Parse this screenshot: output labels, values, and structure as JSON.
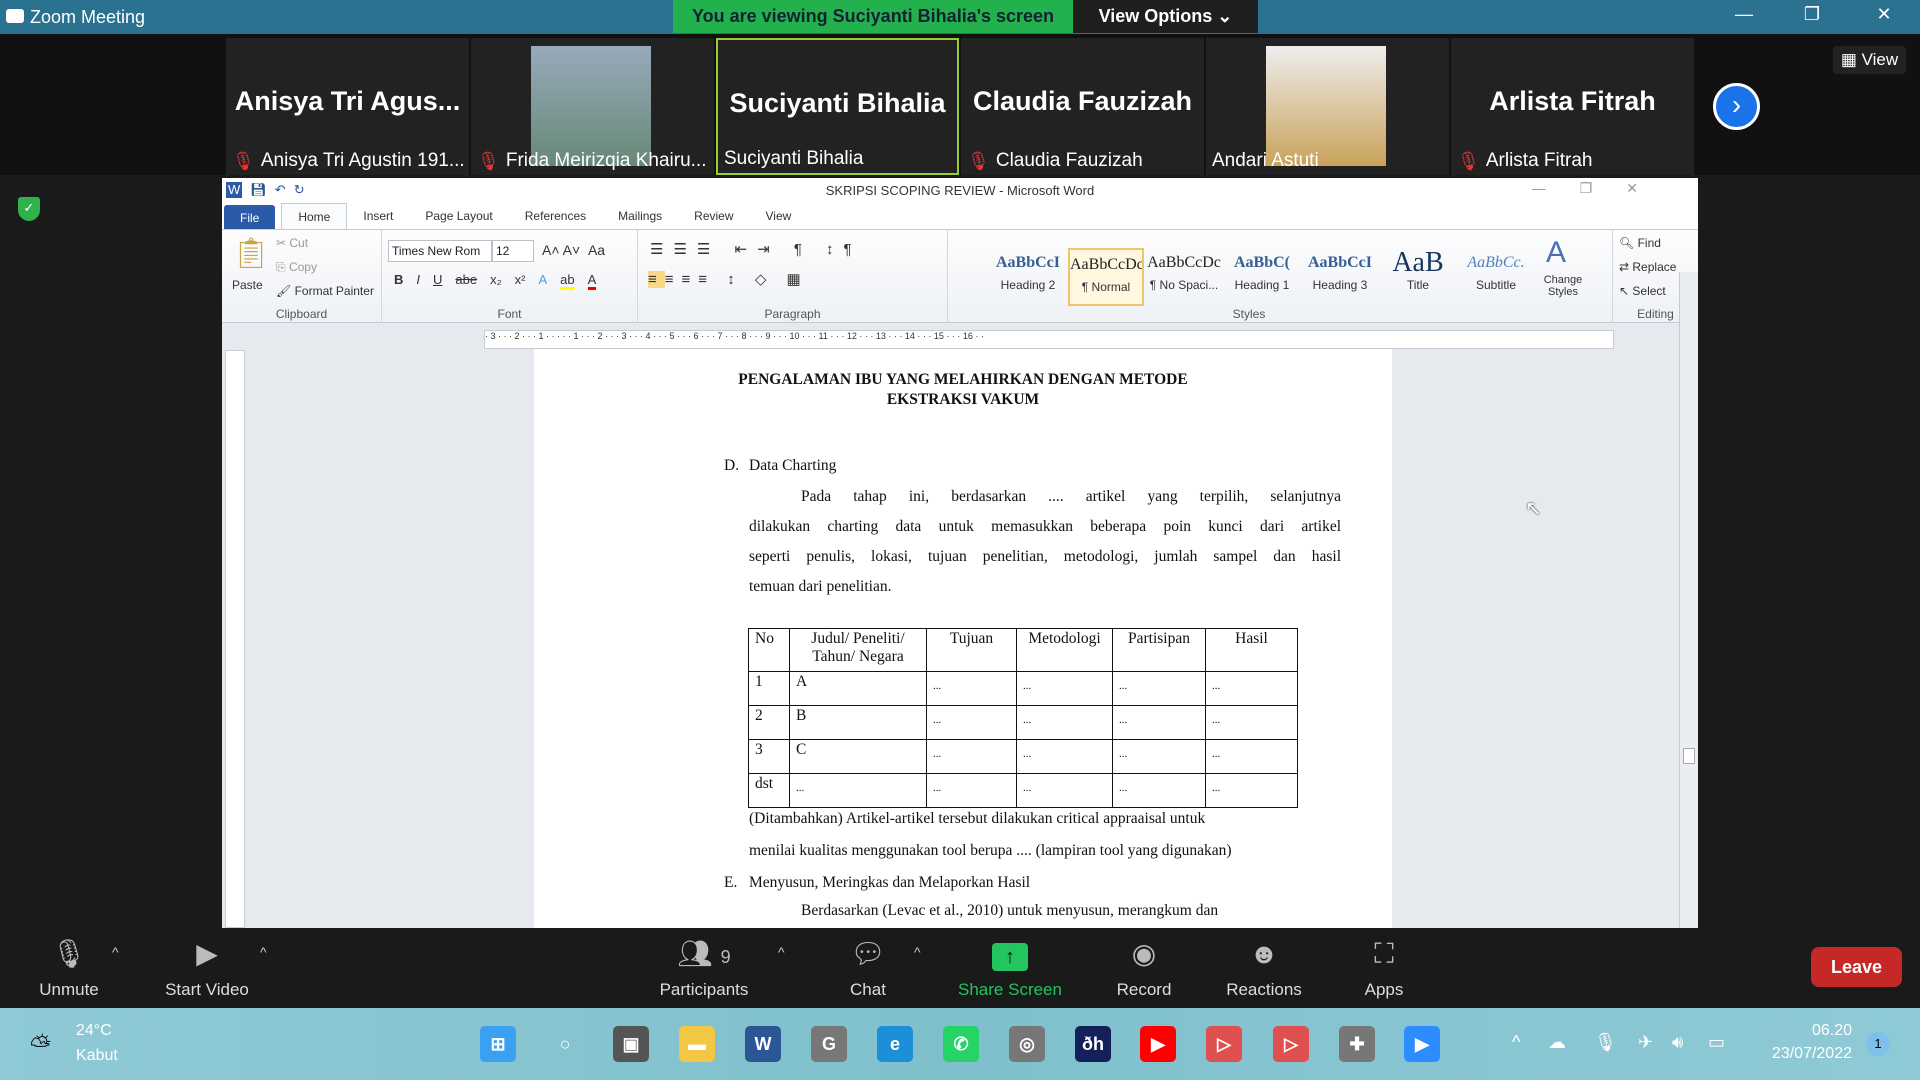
{
  "window": {
    "title": "Zoom Meeting",
    "banner": "You are viewing Suciyanti Bihalia's screen",
    "view_options": "View Options ⌄",
    "minimize": "—",
    "maximize": "❐",
    "close": "✕"
  },
  "participants": [
    {
      "big_name": "Anisya Tri Agus...",
      "label": "Anisya Tri Agustin 191...",
      "muted": true,
      "photo": false
    },
    {
      "big_name": "",
      "label": "Frida Meirizqia Khairu...",
      "muted": true,
      "photo": true
    },
    {
      "big_name": "Suciyanti Bihalia",
      "label": "Suciyanti Bihalia",
      "muted": false,
      "photo": false,
      "active": true
    },
    {
      "big_name": "Claudia Fauzizah",
      "label": "Claudia Fauzizah",
      "muted": true,
      "photo": false
    },
    {
      "big_name": "",
      "label": "Andari Astuti",
      "muted": false,
      "photo": true
    },
    {
      "big_name": "Arlista Fitrah",
      "label": "Arlista Fitrah",
      "muted": true,
      "photo": false
    }
  ],
  "view_button": "View",
  "word": {
    "title": "SKRIPSI SCOPING REVIEW  -  Microsoft Word",
    "tabs": [
      "File",
      "Home",
      "Insert",
      "Page Layout",
      "References",
      "Mailings",
      "Review",
      "View"
    ],
    "clipboard": {
      "paste": "Paste",
      "cut": "Cut",
      "copy": "Copy",
      "format_painter": "Format Painter",
      "label": "Clipboard"
    },
    "font": {
      "name": "Times New Rom",
      "size": "12",
      "label": "Font",
      "bold": "B",
      "italic": "I",
      "underline": "U",
      "strike": "abe",
      "sub": "x₂",
      "sup": "x²",
      "case": "Aa"
    },
    "paragraph_label": "Paragraph",
    "styles": [
      {
        "preview": "AaBbCcI",
        "name": "Heading 2"
      },
      {
        "preview": "AaBbCcDc",
        "name": "¶ Normal",
        "selected": true
      },
      {
        "preview": "AaBbCcDc",
        "name": "¶ No Spaci..."
      },
      {
        "preview": "AaBbC(",
        "name": "Heading 1"
      },
      {
        "preview": "AaBbCcI",
        "name": "Heading 3"
      },
      {
        "preview": "AaB",
        "name": "Title"
      },
      {
        "preview": "AaBbCc.",
        "name": "Subtitle"
      }
    ],
    "styles_label": "Styles",
    "change_styles": "Change Styles",
    "editing": {
      "find": "Find",
      "replace": "Replace",
      "select": "Select",
      "label": "Editing"
    },
    "ruler": "· 3 · · · 2 · · · 1 · · · · · 1 · · · 2 · · · 3 · · · 4 · · · 5 · · · 6 · · · 7 · · · 8 · · · 9 · · · 10 · · · 11 · · · 12 · · · 13 · · · 14 · · · 15 · · · 16 · ·"
  },
  "document": {
    "title1": "PENGALAMAN IBU YANG MELAHIRKAN DENGAN METODE",
    "title2": "EKSTRAKSI VAKUM",
    "sec_d_letter": "D.",
    "sec_d": "Data Charting",
    "para1": [
      "Pada tahap ini, berdasarkan .... artikel yang terpilih, selanjutnya",
      "dilakukan charting data untuk memasukkan beberapa poin kunci dari artikel",
      "seperti penulis, lokasi, tujuan penelitian, metodologi, jumlah sampel dan hasil",
      "temuan dari penelitian."
    ],
    "table": {
      "headers": [
        "No",
        "Judul/ Peneliti/ Tahun/ Negara",
        "Tujuan",
        "Metodologi",
        "Partisipan",
        "Hasil"
      ],
      "rows": [
        [
          "1",
          "A",
          "...",
          "...",
          "...",
          "..."
        ],
        [
          "2",
          "B",
          "...",
          "...",
          "...",
          "..."
        ],
        [
          "3",
          "C",
          "...",
          "...",
          "...",
          "..."
        ],
        [
          "dst",
          "...",
          "...",
          "...",
          "...",
          "..."
        ]
      ]
    },
    "after1": "(Ditambahkan) Artikel-artikel tersebut dilakukan critical appraaisal untuk",
    "after2": "menilai kualitas menggunakan tool berupa .... (lampiran tool yang digunakan)",
    "sec_e_letter": "E.",
    "sec_e": "Menyusun, Meringkas dan Melaporkan Hasil",
    "para2": "Berdasarkan (Levac et al., 2010) untuk menyusun, merangkum dan"
  },
  "controls": {
    "unmute": "Unmute",
    "start_video": "Start Video",
    "participants": "Participants",
    "participant_count": "9",
    "chat": "Chat",
    "share_screen": "Share Screen",
    "record": "Record",
    "reactions": "Reactions",
    "apps": "Apps",
    "leave": "Leave"
  },
  "taskbar": {
    "temp": "24°C",
    "weather": "Kabut",
    "time": "06.20",
    "date": "23/07/2022",
    "notifications": "1",
    "apps": [
      "start",
      "search",
      "task-view",
      "file-explorer",
      "word",
      "chrome",
      "edge",
      "whatsapp",
      "app-green",
      "app-dh",
      "youtube",
      "app-red-1",
      "app-red-2",
      "app-puzzle",
      "zoom"
    ]
  },
  "colors": {
    "accent_green": "#22b14c",
    "leave_red": "#c62828",
    "word_blue": "#2a5aa8"
  }
}
